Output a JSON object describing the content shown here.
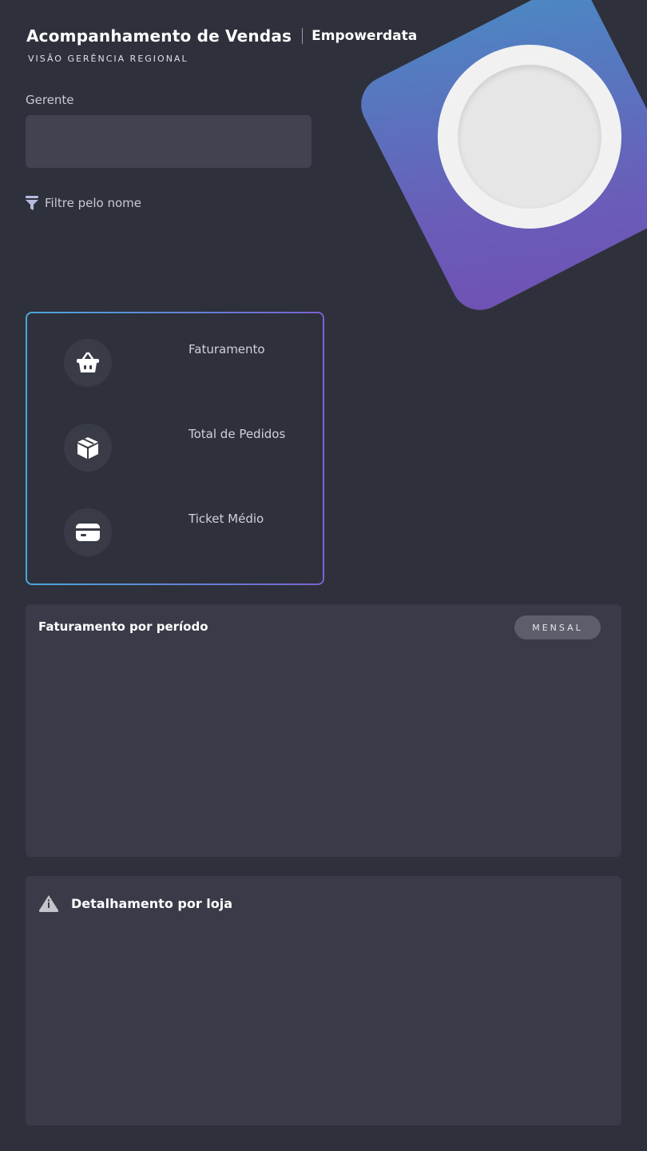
{
  "header": {
    "title": "Acompanhamento de Vendas",
    "brand": "Empowerdata",
    "subtitle": "VISÃO GERÊNCIA REGIONAL"
  },
  "filter": {
    "label": "Gerente",
    "value": "",
    "hint": "Filtre pelo nome",
    "icon": "filter-icon"
  },
  "kpis": [
    {
      "label": "Faturamento",
      "icon": "basket-icon"
    },
    {
      "label": "Total de Pedidos",
      "icon": "box-icon"
    },
    {
      "label": "Ticket Médio",
      "icon": "credit-card-icon"
    }
  ],
  "revenue_panel": {
    "title": "Faturamento por período",
    "period_button": "MENSAL"
  },
  "store_panel": {
    "title": "Detalhamento por loja",
    "icon": "warning-icon"
  },
  "colors": {
    "background": "#2e313b",
    "panel": "#393c48",
    "accent_start": "#4aa8d8",
    "accent_end": "#7a62d4"
  }
}
